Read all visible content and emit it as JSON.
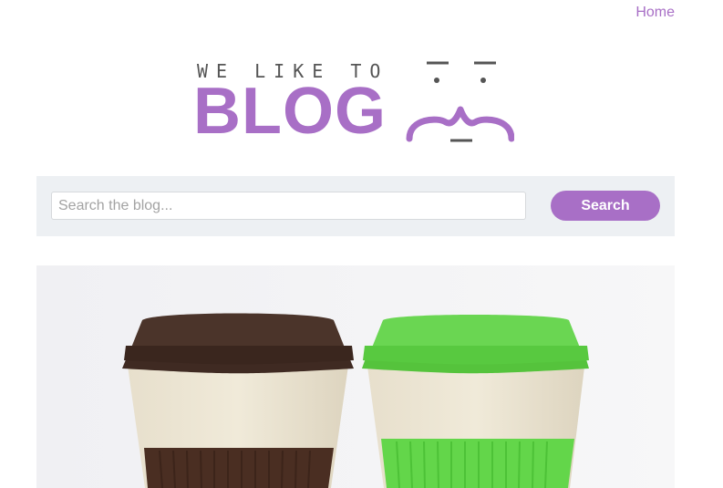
{
  "nav": {
    "home_label": "Home"
  },
  "logo": {
    "tagline": "WE LIKE TO",
    "wordmark": "BLOG"
  },
  "search": {
    "placeholder": "Search the blog...",
    "value": "",
    "button_label": "Search"
  },
  "colors": {
    "accent": "#a86fc6",
    "search_bar_bg": "#edf0f3"
  },
  "hero": {
    "alt": "Two reusable coffee cups, one with a brown lid and sleeve and one with a green lid and sleeve"
  }
}
